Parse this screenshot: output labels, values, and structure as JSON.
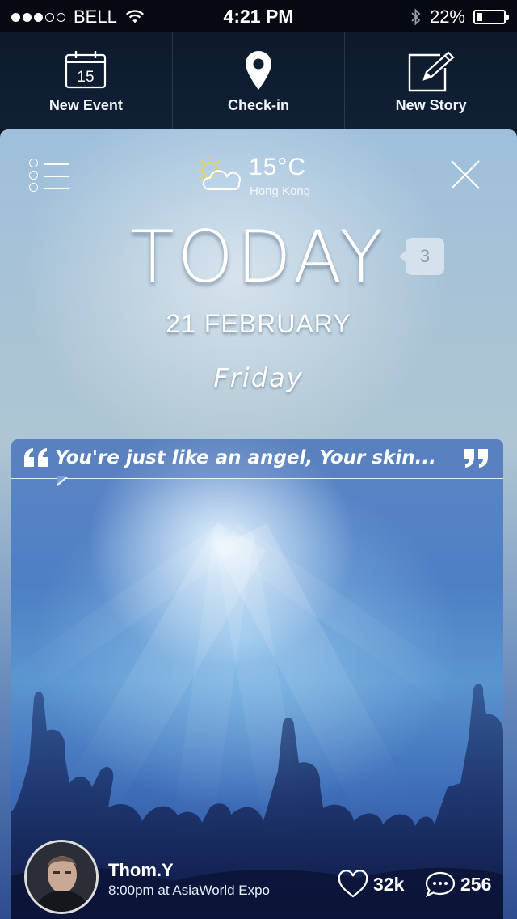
{
  "status_bar": {
    "carrier": "BELL",
    "signal_dots": [
      true,
      true,
      true,
      false,
      false
    ],
    "time": "4:21 PM",
    "battery": "22%",
    "battery_level": 0.22
  },
  "actions": [
    {
      "label": "New Event",
      "icon": "calendar-icon",
      "icon_day": "15"
    },
    {
      "label": "Check-in",
      "icon": "location-pin-icon"
    },
    {
      "label": "New Story",
      "icon": "edit-icon"
    }
  ],
  "weather": {
    "temperature": "15°C",
    "city": "Hong Kong",
    "icon": "partly-cloudy-icon"
  },
  "today": {
    "title": "TODAY",
    "badge_count": "3",
    "date": "21 FEBRUARY",
    "weekday": "Friday"
  },
  "story": {
    "quote": "You're just like an angel, Your skin...",
    "author_name": "Thom.Y",
    "details": "8:00pm at AsiaWorld Expo",
    "likes": "32k",
    "comments": "256"
  },
  "colors": {
    "header_bg": "#0d1a2c",
    "accent": "#5a86c6"
  }
}
